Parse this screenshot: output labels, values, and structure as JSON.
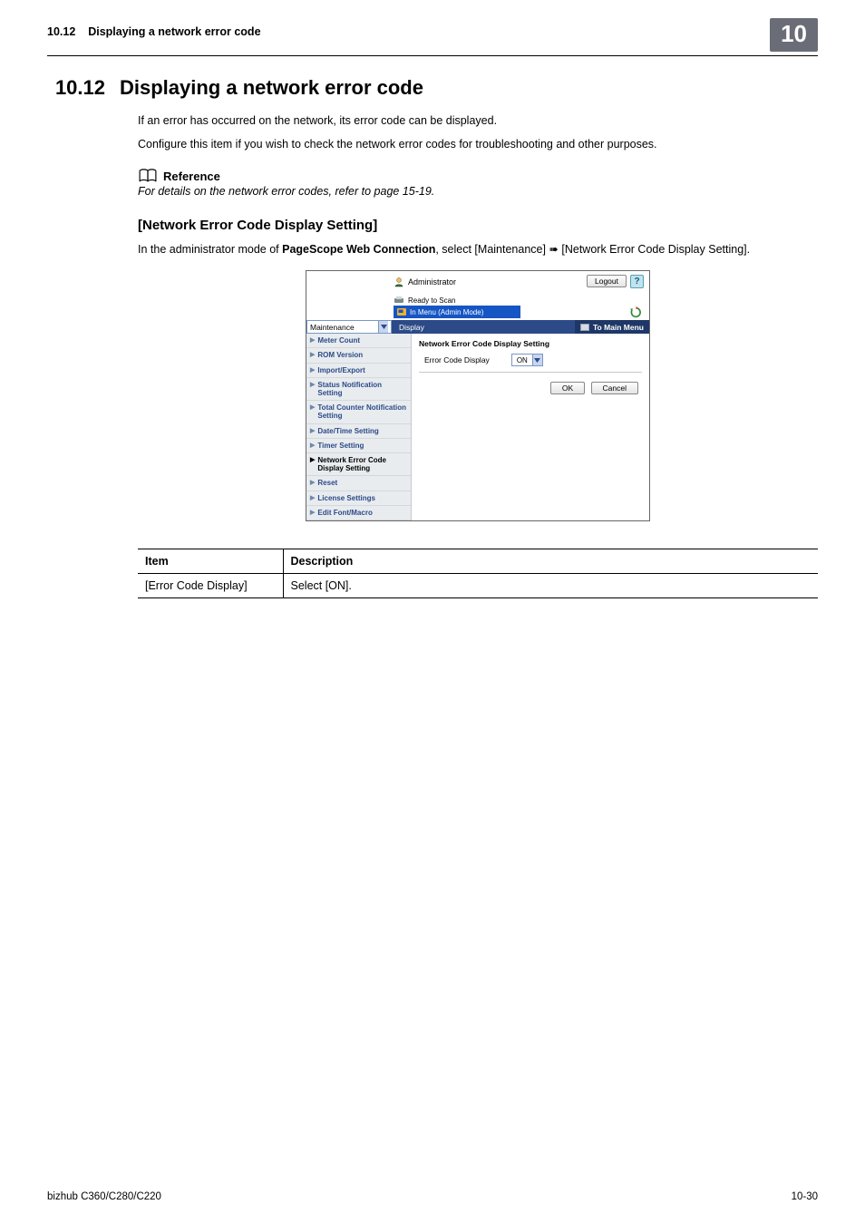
{
  "runhead": {
    "section_ref": "10.12",
    "section_title": "Displaying a network error code",
    "chapter": "10"
  },
  "section": {
    "number": "10.12",
    "title": "Displaying a network error code"
  },
  "paragraphs": {
    "p1": "If an error has occurred on the network, its error code can be displayed.",
    "p2": "Configure this item if you wish to check the network error codes for troubleshooting and other purposes."
  },
  "reference": {
    "label": "Reference",
    "text": "For details on the network error codes, refer to page 15-19."
  },
  "subsection": {
    "title": "[Network Error Code Display Setting]",
    "instr_pre": "In the administrator mode of ",
    "instr_bold": "PageScope Web Connection",
    "instr_post": ", select [Maintenance] ➠ [Network Error Code Display Setting]."
  },
  "screenshot": {
    "administrator": "Administrator",
    "logout": "Logout",
    "help": "?",
    "ready": "Ready to Scan",
    "in_menu": "In Menu (Admin Mode)",
    "select_value": "Maintenance",
    "display_btn": "Display",
    "to_main_menu": "To Main Menu",
    "sidebar": [
      "Meter Count",
      "ROM Version",
      "Import/Export",
      "Status Notification Setting",
      "Total Counter Notification Setting",
      "Date/Time Setting",
      "Timer Setting",
      "Network Error Code Display Setting",
      "Reset",
      "License Settings",
      "Edit Font/Macro"
    ],
    "sidebar_active_index": 7,
    "panel_title": "Network Error Code Display Setting",
    "field_label": "Error Code Display",
    "field_value": "ON",
    "ok": "OK",
    "cancel": "Cancel"
  },
  "table": {
    "headers": {
      "col1": "Item",
      "col2": "Description"
    },
    "rows": [
      {
        "item": "[Error Code Display]",
        "desc": "Select [ON]."
      }
    ]
  },
  "footer": {
    "left": "bizhub C360/C280/C220",
    "right": "10-30"
  }
}
